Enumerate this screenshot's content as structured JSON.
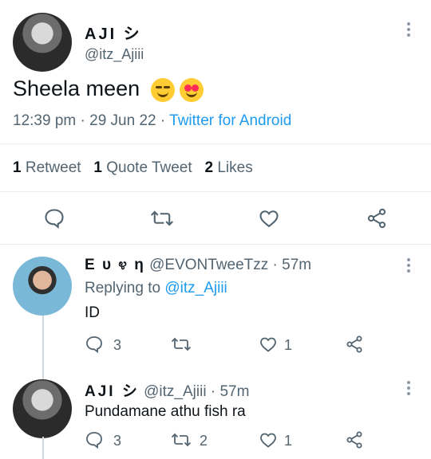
{
  "main_tweet": {
    "author": {
      "name": "AJI シ",
      "handle": "@itz_Ajiii"
    },
    "text": "Sheela meen",
    "emojis": [
      "drooling-face",
      "heart-eyes-face"
    ],
    "time": "12:39 pm",
    "date": "29 Jun 22",
    "dot": "·",
    "source": "Twitter for Android",
    "stats": {
      "retweets_count": "1",
      "retweets_label": "Retweet",
      "quotes_count": "1",
      "quotes_label": "Quote Tweet",
      "likes_count": "2",
      "likes_label": "Likes"
    }
  },
  "replies": [
    {
      "name": "E υ ೪ η",
      "handle": "@EVONTweeTzz",
      "time": "· 57m",
      "replying_prefix": "Replying to",
      "replying_to": "@itz_Ajiii",
      "text": "ID",
      "reply_count": "3",
      "retweet_count": "",
      "like_count": "1"
    },
    {
      "name": "AJI シ",
      "handle": "@itz_Ajiii",
      "time": "· 57m",
      "text": "Pundamane athu fish ra",
      "reply_count": "3",
      "retweet_count": "2",
      "like_count": "1"
    }
  ],
  "colors": {
    "accent": "#1d9bf0",
    "muted": "#536471",
    "text": "#0f1419",
    "divider": "#e6ecf0"
  }
}
